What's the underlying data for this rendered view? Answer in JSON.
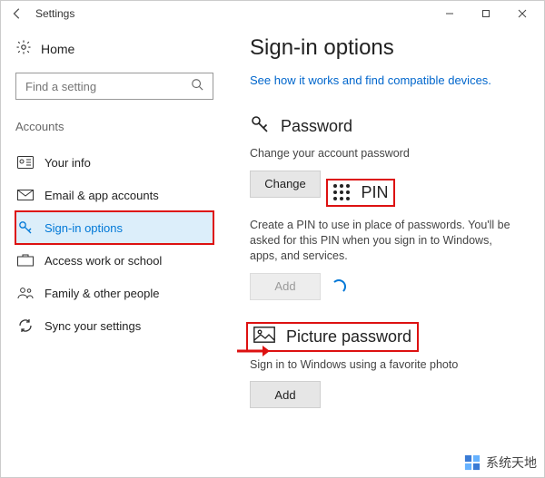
{
  "titlebar": {
    "title": "Settings"
  },
  "sidebar": {
    "home_label": "Home",
    "search_placeholder": "Find a setting",
    "category": "Accounts",
    "items": [
      {
        "label": "Your info"
      },
      {
        "label": "Email & app accounts"
      },
      {
        "label": "Sign-in options"
      },
      {
        "label": "Access work or school"
      },
      {
        "label": "Family & other people"
      },
      {
        "label": "Sync your settings"
      }
    ]
  },
  "main": {
    "title": "Sign-in options",
    "help_link": "See how it works and find compatible devices.",
    "password": {
      "heading": "Password",
      "desc": "Change your account password",
      "button": "Change"
    },
    "pin": {
      "heading": "PIN",
      "desc": "Create a PIN to use in place of passwords. You'll be asked for this PIN when you sign in to Windows, apps, and services.",
      "button": "Add"
    },
    "picture": {
      "heading": "Picture password",
      "desc": "Sign in to Windows using a favorite photo",
      "button": "Add"
    }
  },
  "watermark": {
    "text": "系统天地"
  }
}
